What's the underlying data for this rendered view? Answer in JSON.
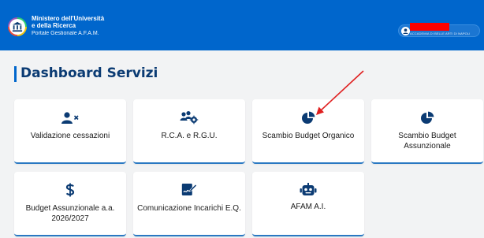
{
  "header": {
    "brand_line1": "Ministero dell'Università",
    "brand_line2": "e della Ricerca",
    "brand_sub": "Portale Gestionale A.F.A.M.",
    "user_org": "ACCADEMIA DI BELLE ARTI DI NAPOLI",
    "colors": {
      "bar": "#0066cc",
      "redaction": "#ff0000"
    }
  },
  "page": {
    "title": "Dashboard Servizi"
  },
  "services": [
    {
      "label": "Validazione cessazioni",
      "icon": "user-remove-icon"
    },
    {
      "label": "R.C.A. e R.G.U.",
      "icon": "users-gear-icon"
    },
    {
      "label": "Scambio Budget Organico",
      "icon": "pie-chart-icon"
    },
    {
      "label": "Scambio Budget Assunzionale",
      "icon": "pie-chart-icon"
    },
    {
      "label": "Budget Assunzionale a.a. 2026/2027",
      "icon": "dollar-icon"
    },
    {
      "label": "Comunicazione Incarichi E.Q.",
      "icon": "signature-icon"
    },
    {
      "label": "AFAM A.I.",
      "icon": "robot-icon"
    }
  ],
  "annotation": {
    "color": "#e02020"
  }
}
